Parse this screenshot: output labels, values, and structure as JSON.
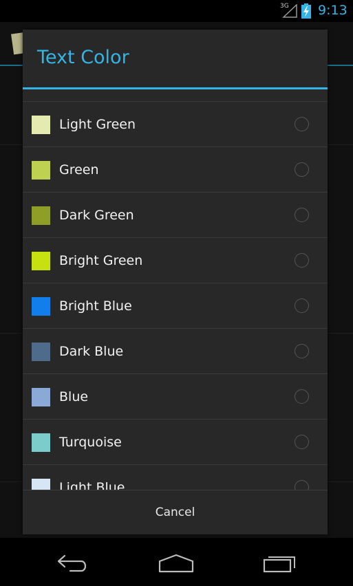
{
  "status_bar": {
    "network": "3G",
    "time": "9:13",
    "accent_color": "#33b5e5"
  },
  "dialog": {
    "title": "Text Color",
    "items": [
      {
        "label": "Light Green",
        "color": "#e5ebb0"
      },
      {
        "label": "Green",
        "color": "#bfd150"
      },
      {
        "label": "Dark Green",
        "color": "#8f9e27"
      },
      {
        "label": "Bright Green",
        "color": "#c7e00f"
      },
      {
        "label": "Bright Blue",
        "color": "#127eec"
      },
      {
        "label": "Dark Blue",
        "color": "#4f6b8c"
      },
      {
        "label": "Blue",
        "color": "#8ba9d6"
      },
      {
        "label": "Turquoise",
        "color": "#7ccccc"
      },
      {
        "label": "Light Blue",
        "color": "#d6e6f5"
      }
    ],
    "cancel_label": "Cancel"
  },
  "nav_bar": {
    "icons": [
      "back-icon",
      "home-icon",
      "recent-apps-icon"
    ]
  }
}
